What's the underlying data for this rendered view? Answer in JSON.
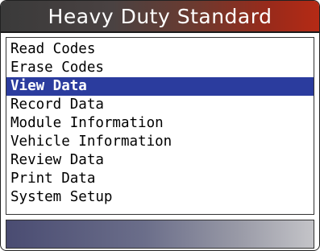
{
  "title": "Heavy Duty Standard",
  "menu": {
    "selected_index": 2,
    "items": [
      {
        "label": "Read Codes"
      },
      {
        "label": "Erase Codes"
      },
      {
        "label": "View Data"
      },
      {
        "label": "Record Data"
      },
      {
        "label": "Module Information"
      },
      {
        "label": "Vehicle Information"
      },
      {
        "label": "Review Data"
      },
      {
        "label": "Print Data"
      },
      {
        "label": "System Setup"
      }
    ]
  },
  "colors": {
    "selection": "#2b3c9e",
    "title_gradient_start": "#3a3a3a",
    "title_gradient_end": "#b52a15"
  }
}
